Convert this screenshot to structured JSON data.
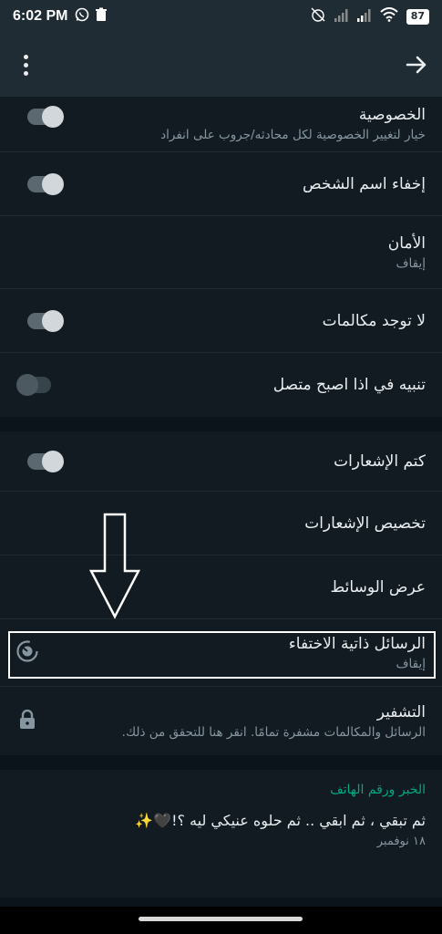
{
  "status_bar": {
    "time": "6:02 PM",
    "battery": "87"
  },
  "settings": {
    "group1": [
      {
        "title": "الخصوصية",
        "subtitle": "خيار لتغيير الخصوصية لكل محادثه/جروب على انفراد"
      },
      {
        "title": "إخفاء اسم الشخص"
      },
      {
        "title": "الأمان",
        "subtitle": "إيقاف"
      },
      {
        "title": "لا توجد مكالمات"
      },
      {
        "title": "تنبيه في اذا اصبح متصل"
      }
    ],
    "group2": [
      {
        "title": "كتم الإشعارات"
      },
      {
        "title": "تخصيص الإشعارات"
      },
      {
        "title": "عرض الوسائط"
      },
      {
        "title": "الرسائل ذاتية الاختفاء",
        "subtitle": "إيقاف"
      },
      {
        "title": "التشفير",
        "subtitle": "الرسائل والمكالمات مشفرة تمامًا. انقر هنا للتحقق من ذلك."
      }
    ]
  },
  "about": {
    "header": "الخبر ورقم الهاتف",
    "text": "ثم تبقي ، ثم ابقي .. ثم حلوه عنيكي ليه ؟!🖤✨",
    "date": "١٨ نوفمبر"
  },
  "toggles": {
    "privacy": true,
    "hide_name": true,
    "no_calls": true,
    "online_alert": false,
    "mute_notifications": true
  }
}
